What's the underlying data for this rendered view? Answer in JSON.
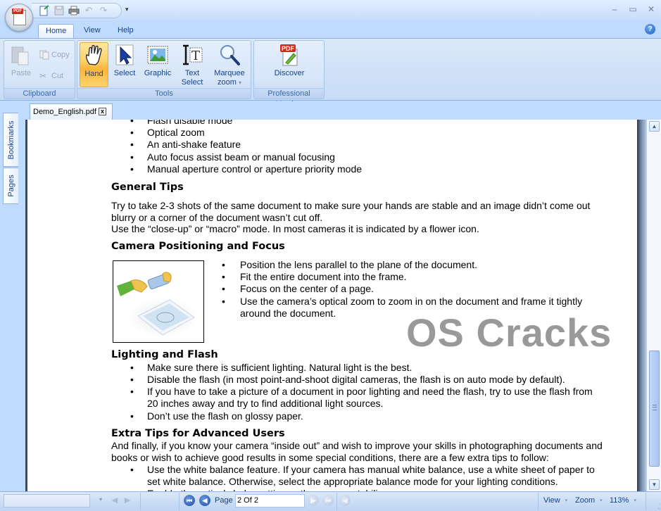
{
  "app": {
    "logo_label": "PDF",
    "quick_access": [
      {
        "name": "new-document-icon",
        "glyph": "🗋"
      },
      {
        "name": "save-icon",
        "glyph": "🖫"
      },
      {
        "name": "print-icon",
        "glyph": "🖶"
      },
      {
        "name": "undo-icon",
        "glyph": "↶"
      },
      {
        "name": "redo-icon",
        "glyph": "↷"
      }
    ],
    "qat_dropdown": "▾",
    "window_controls": {
      "minimize": "–",
      "maximize": "▭",
      "close": "✕"
    },
    "help_glyph": "?"
  },
  "ribbon": {
    "tabs": [
      {
        "label": "Home",
        "active": true
      },
      {
        "label": "View",
        "active": false
      },
      {
        "label": "Help",
        "active": false
      }
    ],
    "groups": {
      "clipboard": {
        "label": "Clipboard",
        "paste": "Paste",
        "copy": "Copy",
        "cut": "Cut"
      },
      "tools": {
        "label": "Tools",
        "hand": "Hand",
        "select": "Select",
        "graphic": "Graphic",
        "text_select_1": "Text",
        "text_select_2": "Select",
        "marquee_1": "Marquee",
        "marquee_2": "zoom",
        "marquee_caret": "▾"
      },
      "professional": {
        "label": "Professional Version",
        "discover": "Discover",
        "pdf_badge": "PDF"
      }
    }
  },
  "document_tab": {
    "filename": "Demo_English.pdf",
    "close_glyph": "x"
  },
  "side_panel": {
    "bookmarks": "Bookmarks",
    "pages": "Pages"
  },
  "page": {
    "top_bullets": [
      "Flash disable mode",
      "Optical zoom",
      "An anti-shake feature",
      "Auto focus assist beam or manual focusing",
      "Manual aperture control or aperture priority mode"
    ],
    "general_tips": {
      "heading": "General Tips",
      "para1": "Try to take 2-3 shots of the same document to make sure your hands are stable and an image didn’t come out blurry or a corner of the document wasn’t cut off.",
      "para2": "Use the “close-up” or “macro” mode. In most cameras it is indicated by a flower icon."
    },
    "camera_positioning": {
      "heading": "Camera Positioning and Focus",
      "bullets": [
        "Position the lens parallel to the plane of the document.",
        "Fit the entire document into the frame.",
        "Focus on the center of a page.",
        "Use the camera’s optical zoom to zoom in on the document and frame it tightly around the document."
      ]
    },
    "lighting": {
      "heading": "Lighting and Flash",
      "bullets": [
        "Make sure there is sufficient lighting. Natural light is the best.",
        "Disable the flash (in most point-and-shoot digital cameras, the flash is on auto mode by default).",
        "If you have to take a picture of a document in poor lighting and need the flash, try to use the flash from 20 inches away and try to find additional light sources.",
        "Don’t use the flash on glossy paper."
      ]
    },
    "extra_tips": {
      "heading": "Extra Tips for Advanced Users",
      "para": "And finally, if you know your camera “inside out” and wish to improve your skills in photographing documents and books or wish to achieve good results in some special conditions, there are a few extra tips to follow:",
      "bullets": [
        "Use the white balance feature. If your camera has manual white balance, use a white sheet of paper to set white balance. Otherwise, select the appropriate balance mode for your lighting conditions.",
        "Enable the optical shake setting or the camera stabilizer"
      ]
    },
    "watermark": "OS Cracks"
  },
  "scrollbar": {
    "up": "▲",
    "down": "▼",
    "position_fraction": 0.72
  },
  "statusbar": {
    "search_value": "",
    "page_label": "Page",
    "page_value": "2 Of 2",
    "view_label": "View",
    "zoom_label": "Zoom",
    "zoom_value": "113%",
    "caret": "▾"
  }
}
